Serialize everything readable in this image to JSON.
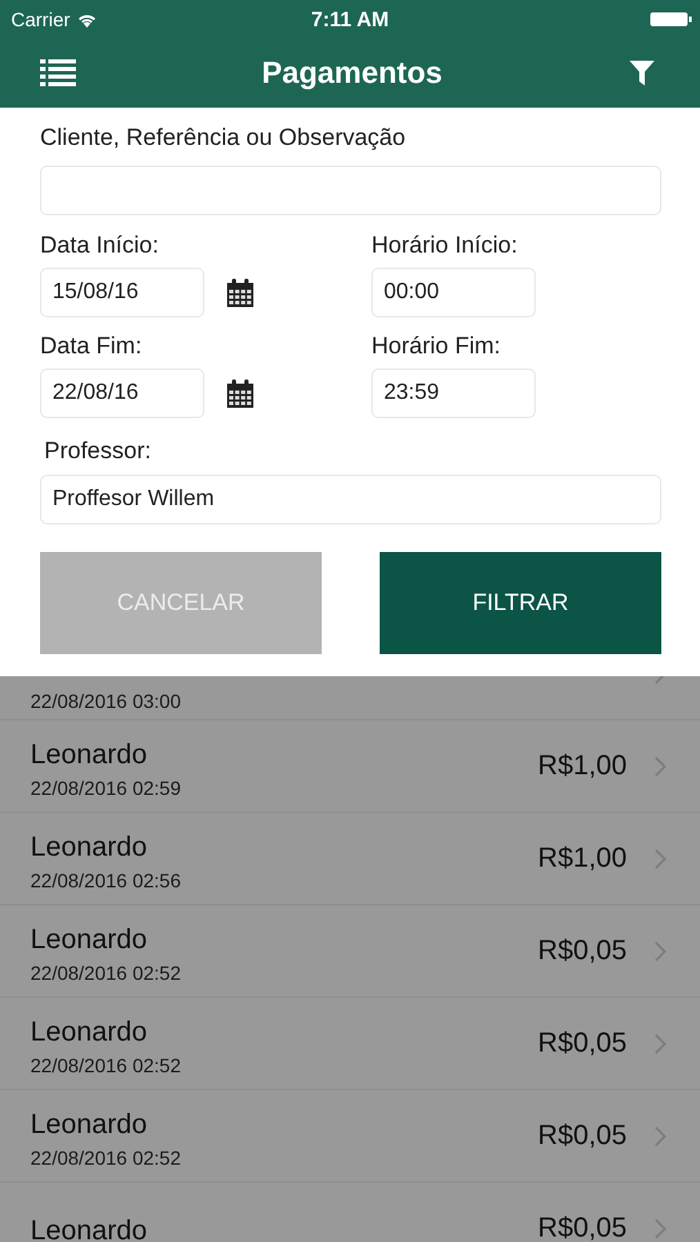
{
  "status_bar": {
    "carrier": "Carrier",
    "time": "7:11 AM"
  },
  "nav": {
    "title": "Pagamentos"
  },
  "filter": {
    "search_label": "Cliente, Referência ou Observação",
    "date_start_label": "Data Início:",
    "date_start": "15/08/16",
    "time_start_label": "Horário Início:",
    "time_start": "00:00",
    "date_end_label": "Data Fim:",
    "date_end": "22/08/16",
    "time_end_label": "Horário Fim:",
    "time_end": "23:59",
    "professor_label": "Professor:",
    "professor": "Proffesor Willem",
    "cancel": "CANCELAR",
    "apply": "FILTRAR"
  },
  "payments": [
    {
      "date": "22/08/2016 03:00"
    },
    {
      "name": "Leonardo",
      "date": "22/08/2016 02:59",
      "amount": "R$1,00"
    },
    {
      "name": "Leonardo",
      "date": "22/08/2016 02:56",
      "amount": "R$1,00"
    },
    {
      "name": "Leonardo",
      "date": "22/08/2016 02:52",
      "amount": "R$0,05"
    },
    {
      "name": "Leonardo",
      "date": "22/08/2016 02:52",
      "amount": "R$0,05"
    },
    {
      "name": "Leonardo",
      "date": "22/08/2016 02:52",
      "amount": "R$0,05"
    },
    {
      "name": "Leonardo",
      "amount": "R$0,05"
    }
  ]
}
